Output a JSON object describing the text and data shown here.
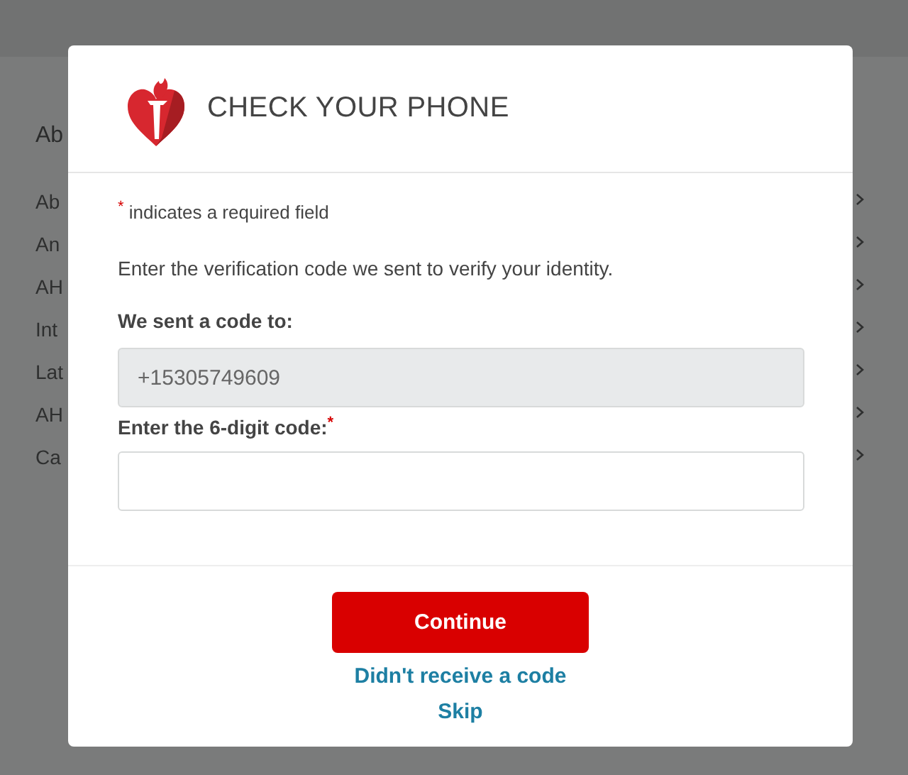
{
  "background_page": {
    "heading": "Ab",
    "links": [
      "Ab",
      "An",
      "AH",
      "Int",
      "Lat",
      "AH",
      "Ca"
    ]
  },
  "dialog": {
    "title": "CHECK YOUR PHONE",
    "required_note": "$^{*}$ indicates a required field",
    "instruction": "Enter the verification code we sent to verify your identity.",
    "phone_label": "We sent a code to:",
    "phone_field": {
      "value": "+15305749609",
      "disabled": true
    },
    "code_label": "Enter the 6-digit code:$^{*}$",
    "code_field": {
      "disabled": false
    },
    "continue_button": "Continue",
    "links": [
      "Didn't receive a code",
      "Skip"
    ]
  }
}
